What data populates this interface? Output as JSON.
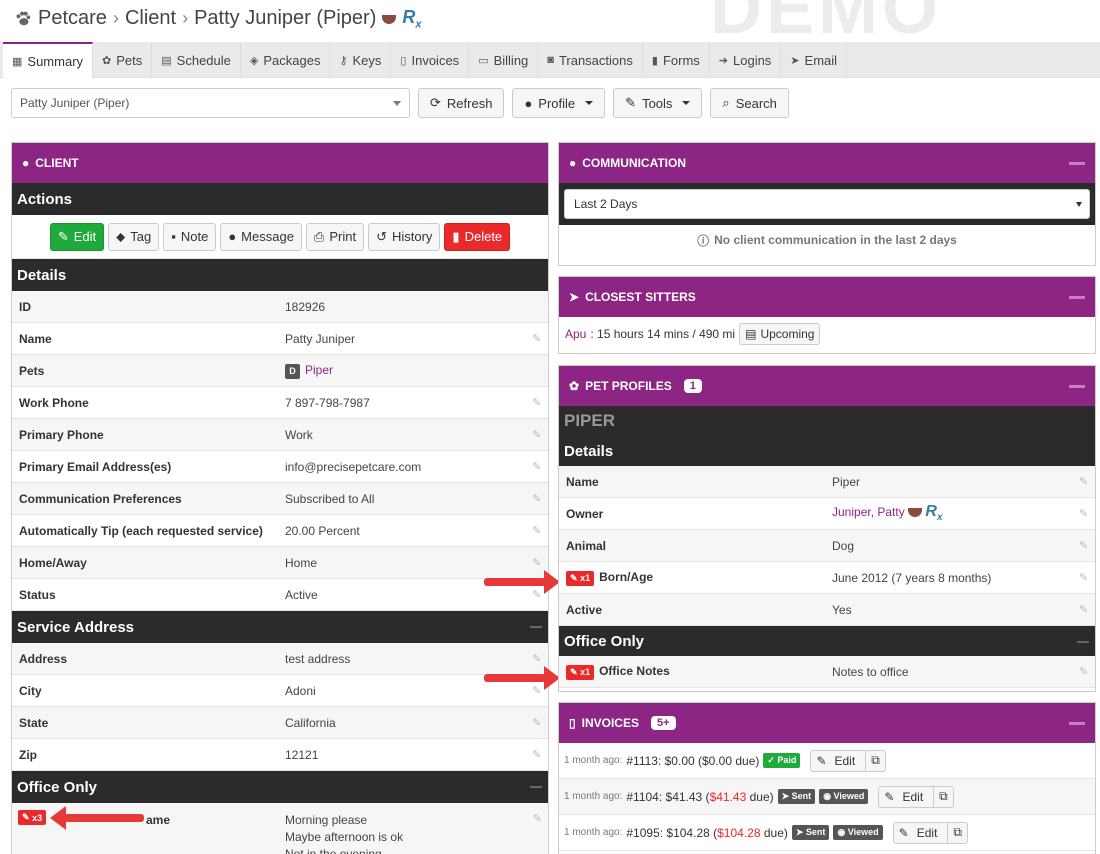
{
  "header": {
    "breadcrumb": [
      "Petcare",
      "Client",
      "Patty Juniper (Piper)"
    ],
    "rx_label": "Rx",
    "watermark": "DEMO"
  },
  "tabs": [
    {
      "label": "Summary",
      "icon": "grid-icon"
    },
    {
      "label": "Pets",
      "icon": "paw-icon"
    },
    {
      "label": "Schedule",
      "icon": "calendar-icon"
    },
    {
      "label": "Packages",
      "icon": "package-icon"
    },
    {
      "label": "Keys",
      "icon": "key-icon"
    },
    {
      "label": "Invoices",
      "icon": "document-icon"
    },
    {
      "label": "Billing",
      "icon": "credit-card-icon"
    },
    {
      "label": "Transactions",
      "icon": "money-icon"
    },
    {
      "label": "Forms",
      "icon": "file-icon"
    },
    {
      "label": "Logins",
      "icon": "sign-in-icon"
    },
    {
      "label": "Email",
      "icon": "send-icon"
    }
  ],
  "toolbar": {
    "client_select": "Patty Juniper (Piper)",
    "refresh": "Refresh",
    "profile": "Profile",
    "tools": "Tools",
    "search": "Search"
  },
  "client": {
    "title": "Client",
    "actions_heading": "Actions",
    "actions": {
      "edit": "Edit",
      "tag": "Tag",
      "note": "Note",
      "message": "Message",
      "print": "Print",
      "history": "History",
      "delete": "Delete"
    },
    "details_heading": "Details",
    "details": [
      {
        "label": "ID",
        "value": "182926"
      },
      {
        "label": "Name",
        "value": "Patty Juniper"
      },
      {
        "label": "Pets",
        "value": "Piper",
        "badge": "D"
      },
      {
        "label": "Work Phone",
        "value": "7 897-798-7987"
      },
      {
        "label": "Primary Phone",
        "value": "Work"
      },
      {
        "label": "Primary Email Address(es)",
        "value": "info@precisepetcare.com"
      },
      {
        "label": "Communication Preferences",
        "value": "Subscribed to All"
      },
      {
        "label": "Automatically Tip (each requested service)",
        "value": "20.00 Percent"
      },
      {
        "label": "Home/Away",
        "value": "Home"
      },
      {
        "label": "Status",
        "value": "Active"
      }
    ],
    "service_heading": "Service Address",
    "service": [
      {
        "label": "Address",
        "value": "test address"
      },
      {
        "label": "City",
        "value": "Adoni"
      },
      {
        "label": "State",
        "value": "California"
      },
      {
        "label": "Zip",
        "value": "12121"
      }
    ],
    "office_heading": "Office Only",
    "office_tag": "x3",
    "office_label_fragment": "ame",
    "office_notes": [
      "Morning please",
      "Maybe afternoon is ok",
      "Not in the evening"
    ]
  },
  "communication": {
    "title": "Communication",
    "select": "Last 2 Days",
    "note": "No client communication in the last 2 days"
  },
  "sitters": {
    "title": "Closest Sitters",
    "name": "Apu",
    "detail": ": 15 hours 14 mins / 490 mi",
    "button": "Upcoming"
  },
  "pet_profiles": {
    "title": "Pet Profiles",
    "count": "1",
    "pet_name": "PIPER",
    "details_heading": "Details",
    "details": [
      {
        "label": "Name",
        "value": "Piper"
      },
      {
        "label": "Owner",
        "value": "Juniper, Patty"
      },
      {
        "label": "Animal",
        "value": "Dog"
      },
      {
        "label": "Born/Age",
        "value": "June  2012 (7 years 8 months)",
        "tag": "x1"
      },
      {
        "label": "Active",
        "value": "Yes"
      }
    ],
    "office_heading": "Office Only",
    "office": {
      "label": "Office Notes",
      "value": "Notes to office",
      "tag": "x1"
    }
  },
  "invoices": {
    "title": "Invoices",
    "count": "5+",
    "rows": [
      {
        "ago": "1 month ago:",
        "text": "#1113: $0.00 ($0.00 due)",
        "status": [
          "Paid"
        ],
        "edit": "Edit"
      },
      {
        "ago": "1 month ago:",
        "pre": "#1104: $41.43 (",
        "due": "$41.43",
        "post": " due)",
        "status": [
          "Sent",
          "Viewed"
        ],
        "edit": "Edit"
      },
      {
        "ago": "1 month ago:",
        "pre": "#1095: $104.28 (",
        "due": "$104.28",
        "post": " due)",
        "status": [
          "Sent",
          "Viewed"
        ],
        "edit": "Edit"
      }
    ]
  },
  "colors": {
    "accent": "#8d2584",
    "green": "#1faa3c",
    "red": "#e9292a"
  }
}
